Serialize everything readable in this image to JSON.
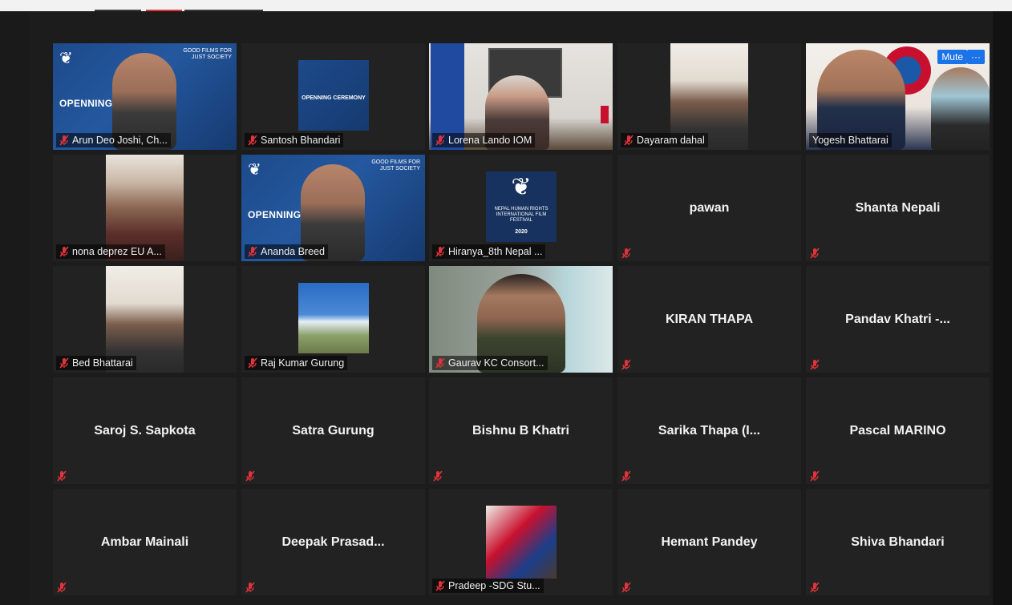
{
  "meeting": {
    "controls": {
      "mute_label": "Mute",
      "more_label": "···"
    },
    "participants": [
      {
        "label": "Arun Deo Joshi, Ch...",
        "video": "festival-poster-person",
        "poster_brand": "GOOD FILMS FOR JUST SOCIETY",
        "poster_title": "OPENNING CEREMONY"
      },
      {
        "label": "Santosh Bhandari",
        "video": "poster-small",
        "poster_title": "OPENNING CEREMONY"
      },
      {
        "label": "Lorena Lando  IOM",
        "video": "office"
      },
      {
        "label": "Dayaram dahal",
        "video": "person-small"
      },
      {
        "label": "Yogesh Bhattarai",
        "video": "speaker",
        "active": true
      },
      {
        "label": "nona deprez EU A...",
        "video": "person-narrow"
      },
      {
        "label": "Ananda Breed",
        "video": "festival-poster-person",
        "poster_brand": "GOOD FILMS FOR JUST SOCIETY",
        "poster_title": "OPENNING CEREMONY"
      },
      {
        "label": "Hiranya_8th Nepal ...",
        "video": "logo",
        "logo_text": "NEPAL HUMAN RIGHTS INTERNATIONAL FILM FESTIVAL",
        "logo_year": "2020"
      },
      {
        "name": "pawan"
      },
      {
        "name": "Shanta Nepali"
      },
      {
        "label": "Bed Bhattarai",
        "video": "person-small"
      },
      {
        "label": "Raj Kumar Gurung",
        "video": "landscape"
      },
      {
        "label": "Gaurav KC Consort...",
        "video": "person-full"
      },
      {
        "name": "KIRAN THAPA"
      },
      {
        "name": "Pandav Khatri -..."
      },
      {
        "name": "Saroj S. Sapkota"
      },
      {
        "name": "Satra  Gurung"
      },
      {
        "name": "Bishnu B Khatri"
      },
      {
        "name": "Sarika Thapa (I..."
      },
      {
        "name": "Pascal MARINO"
      },
      {
        "name": "Ambar Mainali"
      },
      {
        "name": "Deepak  Prasad..."
      },
      {
        "label": "Pradeep -SDG Stu...",
        "video": "flag-person"
      },
      {
        "name": "Hemant Pandey"
      },
      {
        "name": "Shiva Bhandari"
      }
    ]
  },
  "colors": {
    "tile_bg": "#222222",
    "active_border": "#d8e03a",
    "mic_muted": "#e0333a",
    "button": "#1a73e8"
  }
}
